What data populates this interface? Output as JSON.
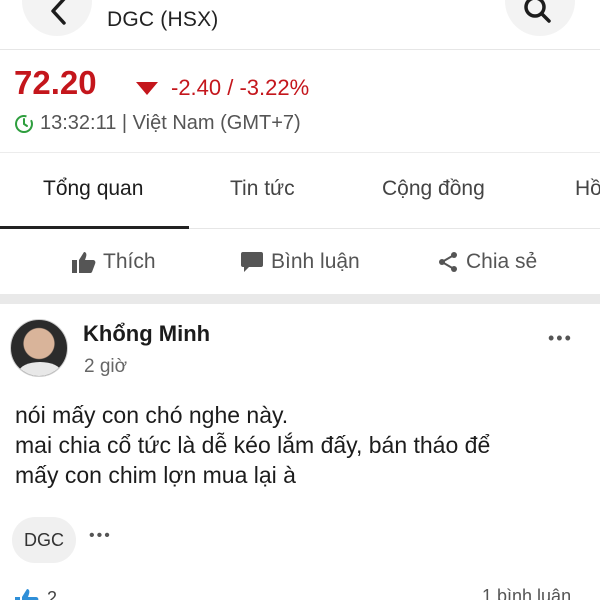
{
  "header": {
    "title": "DGC (HSX)",
    "back_icon": "chevron-left-icon",
    "search_icon": "search-icon"
  },
  "quote": {
    "price": "72.20",
    "change": "-2.40 / -3.22%",
    "time": "13:32:11 | Việt Nam (GMT+7)",
    "down_color": "#c4161c",
    "clock_color": "#2e9e3e"
  },
  "tabs": [
    {
      "label": "Tổng quan",
      "active": true
    },
    {
      "label": "Tin tức",
      "active": false
    },
    {
      "label": "Cộng đồng",
      "active": false
    },
    {
      "label": "Hồ",
      "active": false
    }
  ],
  "actions": {
    "like": "Thích",
    "comment": "Bình luận",
    "share": "Chia sẻ"
  },
  "post": {
    "author": "Khổng Minh",
    "time": "2 giờ",
    "lines": [
      "nói mấy con chó nghe này.",
      "mai chia cổ tức là dễ kéo lắm đấy, bán tháo  để",
      "mấy con chim lợn mua lại à"
    ],
    "tag": "DGC",
    "more": "•••",
    "like_count": "2",
    "comments": "1 bình luận"
  }
}
